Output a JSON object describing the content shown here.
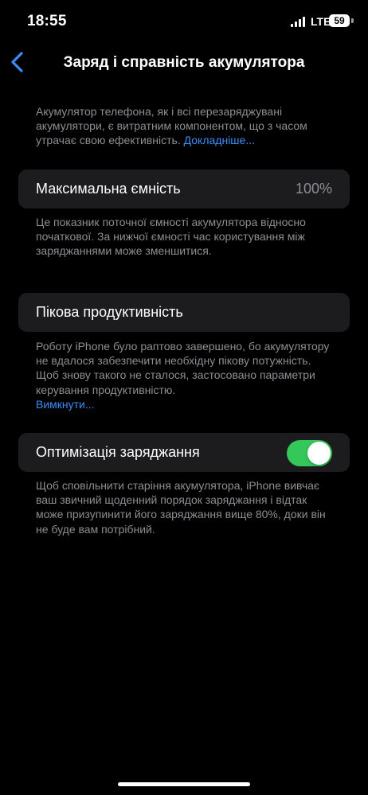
{
  "status_bar": {
    "time": "18:55",
    "carrier": "LTE",
    "battery_level": "59"
  },
  "nav": {
    "title": "Заряд і справність акумулятора",
    "back_icon": "chevron-left-icon"
  },
  "intro": {
    "text": "Акумулятор телефона, як і всі перезаряджувані акумулятори, є витратним компонентом, що з часом утрачає свою ефективність. ",
    "link": "Докладніше..."
  },
  "max_capacity": {
    "label": "Максимальна ємність",
    "value": "100%",
    "footnote": "Це показник поточної ємності акумулятора відносно початкової. За нижчої ємності час користування між заряджаннями може зменшитися."
  },
  "peak_performance": {
    "label": "Пікова продуктивність",
    "footnote": "Роботу iPhone було раптово завершено, бо акумулятору не вдалося забезпечити необхідну пікову потужність. Щоб знову такого не сталося, застосовано параметри керування продуктивністю.",
    "link": "Вимкнути..."
  },
  "optimized_charging": {
    "label": "Оптимізація заряджання",
    "enabled": true,
    "footnote": "Щоб сповільнити старіння акумулятора, iPhone вивчає ваш звичний щоденний порядок заряджання і відтак може призупинити його заряджання вище 80%, доки він не буде вам потрібний."
  },
  "colors": {
    "accent": "#3d8cf6",
    "toggle_on": "#34c759",
    "cell_bg": "#1c1c1e",
    "secondary_text": "#8e8e93"
  }
}
